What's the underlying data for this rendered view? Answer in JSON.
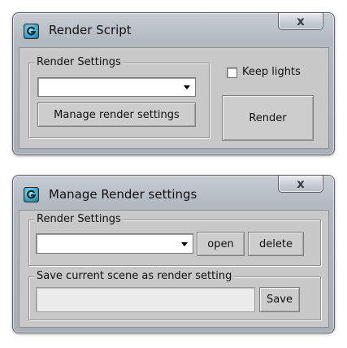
{
  "render_script": {
    "title": "Render Script",
    "close_glyph": "x",
    "group_label": "Render Settings",
    "dropdown_value": "",
    "manage_button": "Manage render settings",
    "keep_lights_label": "Keep lights",
    "keep_lights_checked": false,
    "render_button": "Render"
  },
  "manage_render": {
    "title": "Manage Render settings",
    "close_glyph": "x",
    "group1_label": "Render Settings",
    "dropdown_value": "",
    "open_button": "open",
    "delete_button": "delete",
    "group2_label": "Save current scene as render setting",
    "save_input_value": "",
    "save_button": "Save"
  },
  "icons": {
    "app": "3dsmax-app-icon",
    "close": "close-icon",
    "dropdown": "chevron-down-icon"
  },
  "colors": {
    "frame": "#b4bac2",
    "client": "#c8c8c8",
    "icon_teal": "#2f98b8"
  }
}
